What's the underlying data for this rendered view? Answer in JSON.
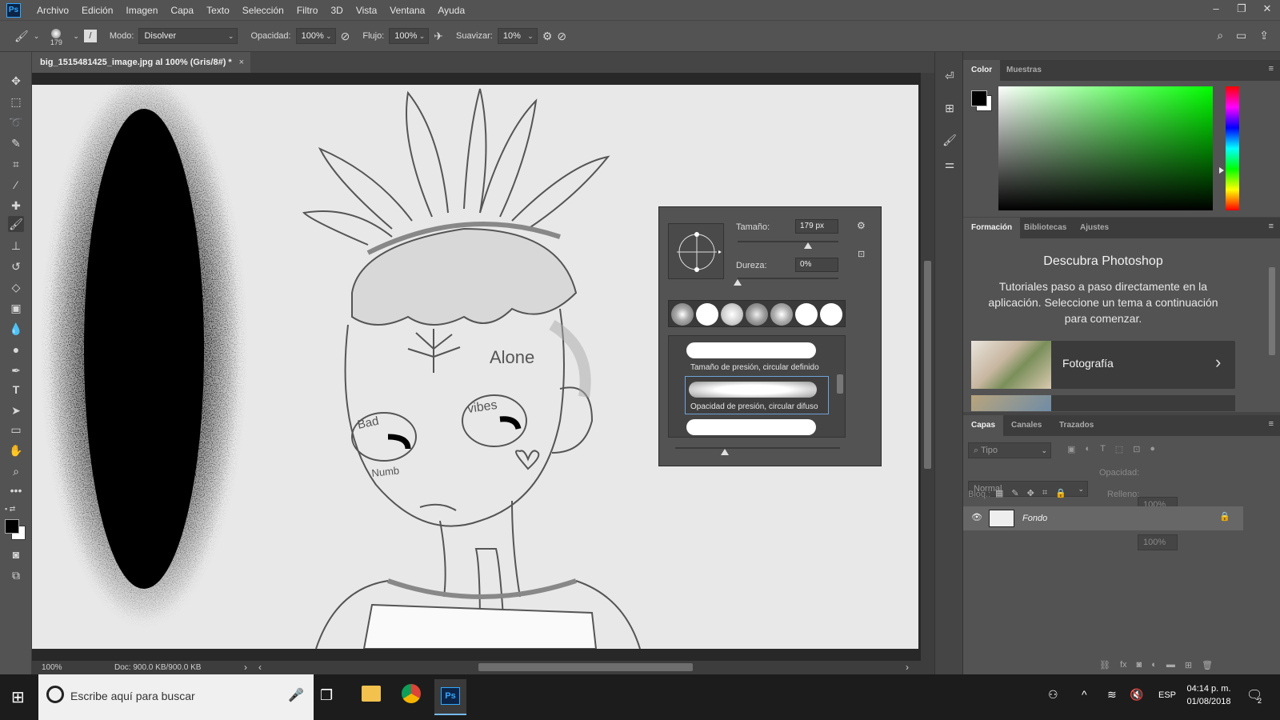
{
  "menu": {
    "logo": "Ps",
    "items": [
      "Archivo",
      "Edición",
      "Imagen",
      "Capa",
      "Texto",
      "Selección",
      "Filtro",
      "3D",
      "Vista",
      "Ventana",
      "Ayuda"
    ]
  },
  "options_bar": {
    "brush_size": "179",
    "mode_label": "Modo:",
    "mode_value": "Disolver",
    "opacity_label": "Opacidad:",
    "opacity_value": "100%",
    "flow_label": "Flujo:",
    "flow_value": "100%",
    "smoothing_label": "Suavizar:",
    "smoothing_value": "10%"
  },
  "document": {
    "tab_title": "big_1515481425_image.jpg al 100% (Gris/8#) *",
    "zoom": "100%",
    "doc_info": "Doc: 900.0 KB/900.0 KB"
  },
  "brush_popup": {
    "size_label": "Tamaño:",
    "size_value": "179 px",
    "size_level": 0.7,
    "hardness_label": "Dureza:",
    "hardness_value": "0%",
    "hardness_level": 0,
    "presets": [
      {
        "label": "Tamaño de presión, circular definido"
      },
      {
        "label": "Opacidad de presión, circular difuso"
      },
      {
        "label": ""
      }
    ]
  },
  "color_panel": {
    "tabs": [
      "Color",
      "Muestras"
    ],
    "foreground": "#000000",
    "background": "#ffffff",
    "hue": "#00ff00"
  },
  "learn_panel": {
    "tabs": [
      "Formación",
      "Bibliotecas",
      "Ajustes"
    ],
    "title": "Descubra Photoshop",
    "body": "Tutoriales paso a paso directamente en la aplicación. Seleccione un tema a continuación para comenzar.",
    "card_label": "Fotografía"
  },
  "layers_panel": {
    "tabs": [
      "Capas",
      "Canales",
      "Trazados"
    ],
    "filter_placeholder": "Tipo",
    "blend_mode": "Normal",
    "opacity_label": "Opacidad:",
    "opacity_value": "100%",
    "lock_label": "Bloq.:",
    "fill_label": "Relleno:",
    "fill_value": "100%",
    "layers": [
      {
        "name": "Fondo",
        "locked": true,
        "visible": true
      }
    ]
  },
  "taskbar": {
    "search_placeholder": "Escribe aquí para buscar",
    "language": "ESP",
    "time": "04:14 p. m.",
    "date": "01/08/2018",
    "notification_count": "2"
  },
  "canvas_text": {
    "alone": "Alone",
    "vibes": "vibes",
    "bad": "Bad",
    "numb": "Numb"
  }
}
